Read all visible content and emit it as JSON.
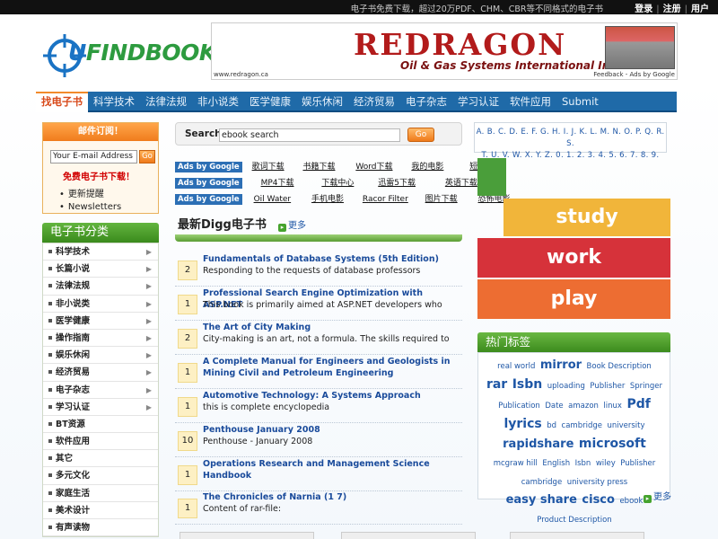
{
  "topbar": {
    "tagline": "电子书免费下载，超过20万PDF、CHM、CBR等不同格式的电子书",
    "login": "登录",
    "register": "注册",
    "user": "用户"
  },
  "logo": {
    "text_u": "U",
    "text_rest": "FINDBOOK"
  },
  "banner": {
    "title": "REDRAGON",
    "subtitle": "Oil & Gas Systems International Inc",
    "url": "www.redragon.ca",
    "ads": "Feedback - Ads by Google"
  },
  "nav": {
    "items": [
      "找电子书",
      "科学技术",
      "法律法规",
      "非小说类",
      "医学健康",
      "娱乐休闲",
      "经济贸易",
      "电子杂志",
      "学习认证",
      "软件应用",
      "Submit"
    ]
  },
  "subscribe": {
    "title": "邮件订阅！",
    "email_placeholder": "Your E-mail Address",
    "go": "Go",
    "free": "免费电子书下载！",
    "links": [
      "更新提醒",
      "Newsletters"
    ]
  },
  "categories": {
    "title": "电子书分类",
    "items": [
      "科学技术",
      "长篇小说",
      "法律法规",
      "非小说类",
      "医学健康",
      "操作指南",
      "娱乐休闲",
      "经济贸易",
      "电子杂志",
      "学习认证",
      "BT资源",
      "软件应用",
      "其它",
      "多元文化",
      "家庭生活",
      "美术设计",
      "有声读物"
    ]
  },
  "search": {
    "label": "Search:",
    "value": "ebook search",
    "go": "Go"
  },
  "ads": {
    "badge": "Ads by Google",
    "rows": [
      [
        "歌词下载",
        "书籍下载",
        "Word下载",
        "我的电影",
        "短片下载"
      ],
      [
        "MP4下载",
        "下载中心",
        "迅雷5下载",
        "英语下载"
      ],
      [
        "Oil Water",
        "手机电影",
        "Racor Filter",
        "图片下载",
        "恐怖电影"
      ]
    ]
  },
  "digg": {
    "title": "最新Digg电子书",
    "more": "更多",
    "books": [
      {
        "n": "2",
        "title": "Fundamentals of Database Systems (5th Edition)",
        "desc": "Responding to the requests of database professors"
      },
      {
        "n": "1",
        "title": "Professional Search Engine Optimization with ASP.NET",
        "desc": "This book is primarily aimed at ASP.NET developers who"
      },
      {
        "n": "2",
        "title": "The Art of City Making",
        "desc": "City-making is an art, not a formula. The skills required to"
      },
      {
        "n": "1",
        "title": "A Complete Manual for Engineers and Geologists in Mining Civil and Petroleum Engineering",
        "desc": ""
      },
      {
        "n": "1",
        "title": "Automotive Technology: A Systems Approach",
        "desc": "this is complete encyclopedia"
      },
      {
        "n": "10",
        "title": "Penthouse January 2008",
        "desc": "Penthouse - January 2008"
      },
      {
        "n": "1",
        "title": "Operations Research and Management Science Handbook",
        "desc": ""
      },
      {
        "n": "1",
        "title": "The Chronicles of Narnia (1 7)",
        "desc": "Content of rar-file:"
      }
    ]
  },
  "alphabet": {
    "line1": "A. B. C. D. E. F. G. H. I. J. K. L. M. N. O. P. Q. R. S.",
    "line2": "T. U. V. W. X. Y. Z. 0. 1. 2. 3. 4. 5. 6. 7. 8. 9."
  },
  "tiles": {
    "study": "study",
    "work": "work",
    "play": "play"
  },
  "hot_tags": {
    "title": "热门标签",
    "more": "更多",
    "tags": [
      {
        "t": "real world",
        "s": 9
      },
      {
        "t": "mirror",
        "s": 13
      },
      {
        "t": "Book Description",
        "s": 9
      },
      {
        "t": "rar",
        "s": 14
      },
      {
        "t": "Isbn",
        "s": 14
      },
      {
        "t": "uploading",
        "s": 9
      },
      {
        "t": "Publisher",
        "s": 9
      },
      {
        "t": "Springer",
        "s": 9
      },
      {
        "t": "Publication",
        "s": 9
      },
      {
        "t": "Date",
        "s": 9
      },
      {
        "t": "amazon",
        "s": 9
      },
      {
        "t": "linux",
        "s": 9
      },
      {
        "t": "Pdf",
        "s": 14
      },
      {
        "t": "lyrics",
        "s": 14
      },
      {
        "t": "bd",
        "s": 9
      },
      {
        "t": "cambridge",
        "s": 9
      },
      {
        "t": "university",
        "s": 9
      },
      {
        "t": "rapidshare",
        "s": 13
      },
      {
        "t": "microsoft",
        "s": 14
      },
      {
        "t": "mcgraw hill",
        "s": 9
      },
      {
        "t": "English",
        "s": 9
      },
      {
        "t": "Isbn",
        "s": 9
      },
      {
        "t": "wiley",
        "s": 9
      },
      {
        "t": "Publisher",
        "s": 9
      },
      {
        "t": "cambridge",
        "s": 9
      },
      {
        "t": "university press",
        "s": 9
      },
      {
        "t": "easy share",
        "s": 13
      },
      {
        "t": "cisco",
        "s": 13
      },
      {
        "t": "ebook",
        "s": 9
      },
      {
        "t": "Product Description",
        "s": 9
      }
    ]
  },
  "colors": {
    "nav_blue": "#1f6aa8",
    "orange": "#f07c1c",
    "green": "#3a8a1c",
    "study": "#f1b53a",
    "work": "#d6323a",
    "play": "#ed6d32",
    "tile_small": "#4a9e3a"
  }
}
